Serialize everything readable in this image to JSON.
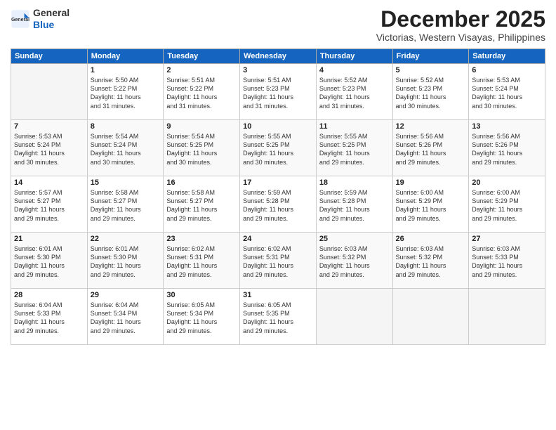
{
  "header": {
    "logo_general": "General",
    "logo_blue": "Blue",
    "month_title": "December 2025",
    "subtitle": "Victorias, Western Visayas, Philippines"
  },
  "days_of_week": [
    "Sunday",
    "Monday",
    "Tuesday",
    "Wednesday",
    "Thursday",
    "Friday",
    "Saturday"
  ],
  "weeks": [
    [
      {
        "day": "",
        "info": ""
      },
      {
        "day": "1",
        "info": "Sunrise: 5:50 AM\nSunset: 5:22 PM\nDaylight: 11 hours\nand 31 minutes."
      },
      {
        "day": "2",
        "info": "Sunrise: 5:51 AM\nSunset: 5:22 PM\nDaylight: 11 hours\nand 31 minutes."
      },
      {
        "day": "3",
        "info": "Sunrise: 5:51 AM\nSunset: 5:23 PM\nDaylight: 11 hours\nand 31 minutes."
      },
      {
        "day": "4",
        "info": "Sunrise: 5:52 AM\nSunset: 5:23 PM\nDaylight: 11 hours\nand 31 minutes."
      },
      {
        "day": "5",
        "info": "Sunrise: 5:52 AM\nSunset: 5:23 PM\nDaylight: 11 hours\nand 30 minutes."
      },
      {
        "day": "6",
        "info": "Sunrise: 5:53 AM\nSunset: 5:24 PM\nDaylight: 11 hours\nand 30 minutes."
      }
    ],
    [
      {
        "day": "7",
        "info": "Sunrise: 5:53 AM\nSunset: 5:24 PM\nDaylight: 11 hours\nand 30 minutes."
      },
      {
        "day": "8",
        "info": "Sunrise: 5:54 AM\nSunset: 5:24 PM\nDaylight: 11 hours\nand 30 minutes."
      },
      {
        "day": "9",
        "info": "Sunrise: 5:54 AM\nSunset: 5:25 PM\nDaylight: 11 hours\nand 30 minutes."
      },
      {
        "day": "10",
        "info": "Sunrise: 5:55 AM\nSunset: 5:25 PM\nDaylight: 11 hours\nand 30 minutes."
      },
      {
        "day": "11",
        "info": "Sunrise: 5:55 AM\nSunset: 5:25 PM\nDaylight: 11 hours\nand 29 minutes."
      },
      {
        "day": "12",
        "info": "Sunrise: 5:56 AM\nSunset: 5:26 PM\nDaylight: 11 hours\nand 29 minutes."
      },
      {
        "day": "13",
        "info": "Sunrise: 5:56 AM\nSunset: 5:26 PM\nDaylight: 11 hours\nand 29 minutes."
      }
    ],
    [
      {
        "day": "14",
        "info": "Sunrise: 5:57 AM\nSunset: 5:27 PM\nDaylight: 11 hours\nand 29 minutes."
      },
      {
        "day": "15",
        "info": "Sunrise: 5:58 AM\nSunset: 5:27 PM\nDaylight: 11 hours\nand 29 minutes."
      },
      {
        "day": "16",
        "info": "Sunrise: 5:58 AM\nSunset: 5:27 PM\nDaylight: 11 hours\nand 29 minutes."
      },
      {
        "day": "17",
        "info": "Sunrise: 5:59 AM\nSunset: 5:28 PM\nDaylight: 11 hours\nand 29 minutes."
      },
      {
        "day": "18",
        "info": "Sunrise: 5:59 AM\nSunset: 5:28 PM\nDaylight: 11 hours\nand 29 minutes."
      },
      {
        "day": "19",
        "info": "Sunrise: 6:00 AM\nSunset: 5:29 PM\nDaylight: 11 hours\nand 29 minutes."
      },
      {
        "day": "20",
        "info": "Sunrise: 6:00 AM\nSunset: 5:29 PM\nDaylight: 11 hours\nand 29 minutes."
      }
    ],
    [
      {
        "day": "21",
        "info": "Sunrise: 6:01 AM\nSunset: 5:30 PM\nDaylight: 11 hours\nand 29 minutes."
      },
      {
        "day": "22",
        "info": "Sunrise: 6:01 AM\nSunset: 5:30 PM\nDaylight: 11 hours\nand 29 minutes."
      },
      {
        "day": "23",
        "info": "Sunrise: 6:02 AM\nSunset: 5:31 PM\nDaylight: 11 hours\nand 29 minutes."
      },
      {
        "day": "24",
        "info": "Sunrise: 6:02 AM\nSunset: 5:31 PM\nDaylight: 11 hours\nand 29 minutes."
      },
      {
        "day": "25",
        "info": "Sunrise: 6:03 AM\nSunset: 5:32 PM\nDaylight: 11 hours\nand 29 minutes."
      },
      {
        "day": "26",
        "info": "Sunrise: 6:03 AM\nSunset: 5:32 PM\nDaylight: 11 hours\nand 29 minutes."
      },
      {
        "day": "27",
        "info": "Sunrise: 6:03 AM\nSunset: 5:33 PM\nDaylight: 11 hours\nand 29 minutes."
      }
    ],
    [
      {
        "day": "28",
        "info": "Sunrise: 6:04 AM\nSunset: 5:33 PM\nDaylight: 11 hours\nand 29 minutes."
      },
      {
        "day": "29",
        "info": "Sunrise: 6:04 AM\nSunset: 5:34 PM\nDaylight: 11 hours\nand 29 minutes."
      },
      {
        "day": "30",
        "info": "Sunrise: 6:05 AM\nSunset: 5:34 PM\nDaylight: 11 hours\nand 29 minutes."
      },
      {
        "day": "31",
        "info": "Sunrise: 6:05 AM\nSunset: 5:35 PM\nDaylight: 11 hours\nand 29 minutes."
      },
      {
        "day": "",
        "info": ""
      },
      {
        "day": "",
        "info": ""
      },
      {
        "day": "",
        "info": ""
      }
    ]
  ]
}
